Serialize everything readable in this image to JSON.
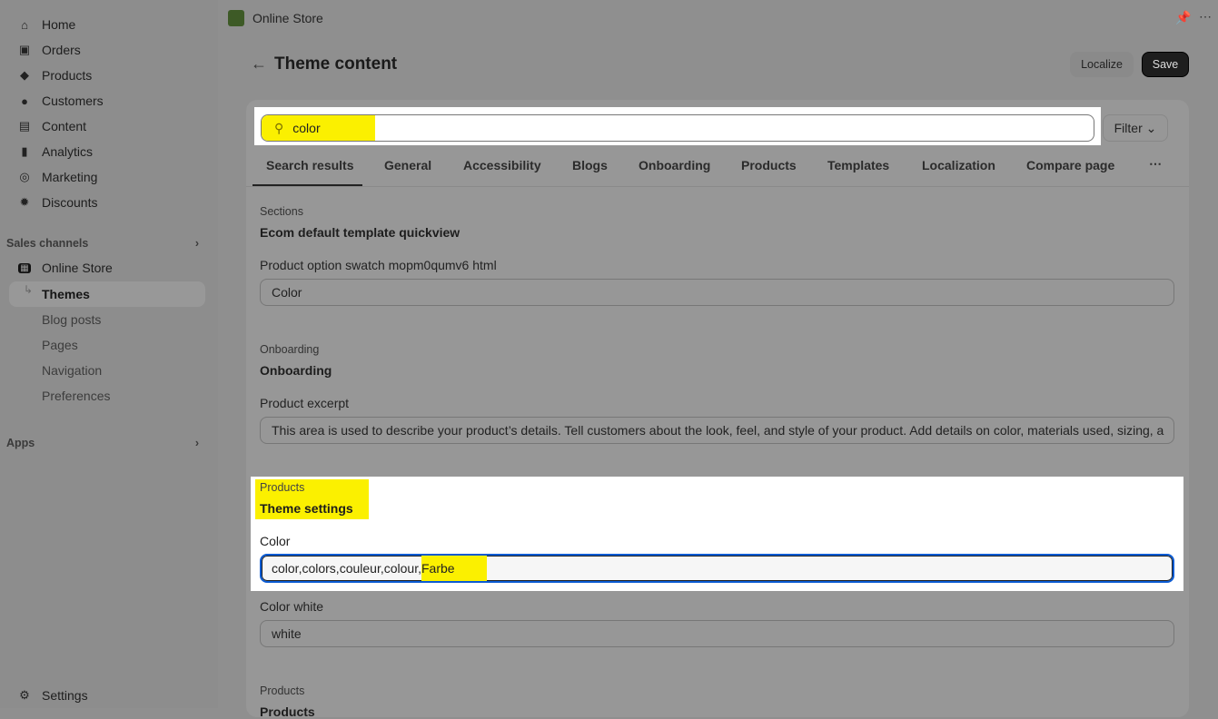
{
  "sidebar": {
    "items": [
      {
        "label": "Home",
        "icon": "home-icon"
      },
      {
        "label": "Orders",
        "icon": "inbox-icon"
      },
      {
        "label": "Products",
        "icon": "tag-icon"
      },
      {
        "label": "Customers",
        "icon": "person-icon"
      },
      {
        "label": "Content",
        "icon": "content-icon"
      },
      {
        "label": "Analytics",
        "icon": "bar-chart-icon"
      },
      {
        "label": "Marketing",
        "icon": "target-icon"
      },
      {
        "label": "Discounts",
        "icon": "discount-icon"
      }
    ],
    "sales_channels": "Sales channels",
    "online_store": "Online Store",
    "themes": "Themes",
    "subitems": [
      "Blog posts",
      "Pages",
      "Navigation",
      "Preferences"
    ],
    "apps": "Apps",
    "settings": "Settings"
  },
  "header": {
    "app_title": "Online Store",
    "page_title": "Theme content",
    "localize": "Localize",
    "save": "Save"
  },
  "search": {
    "value": "color",
    "filter": "Filter"
  },
  "tabs": [
    "Search results",
    "General",
    "Accessibility",
    "Blogs",
    "Onboarding",
    "Products",
    "Templates",
    "Localization",
    "Compare page"
  ],
  "results": [
    {
      "category": "Sections",
      "title": "Ecom default template quickview",
      "label": "Product option swatch mopm0qumv6 html",
      "value": "Color"
    },
    {
      "category": "Onboarding",
      "title": "Onboarding",
      "label": "Product excerpt",
      "value": "This area is used to describe your product’s details. Tell customers about the look, feel, and style of your product. Add details on color, materials used, sizing, a"
    },
    {
      "category": "Products",
      "title": "Theme settings",
      "label": "Color",
      "value_prefix": "color,colors,couleur,colour,",
      "value_highlight": "Farbe",
      "label2": "Color white",
      "value2": "white"
    },
    {
      "category": "Products",
      "title": "Products"
    }
  ],
  "colors": {
    "highlight": "#fbf000",
    "focus": "#0b5bd3",
    "save_bg": "#1e1e1e"
  }
}
